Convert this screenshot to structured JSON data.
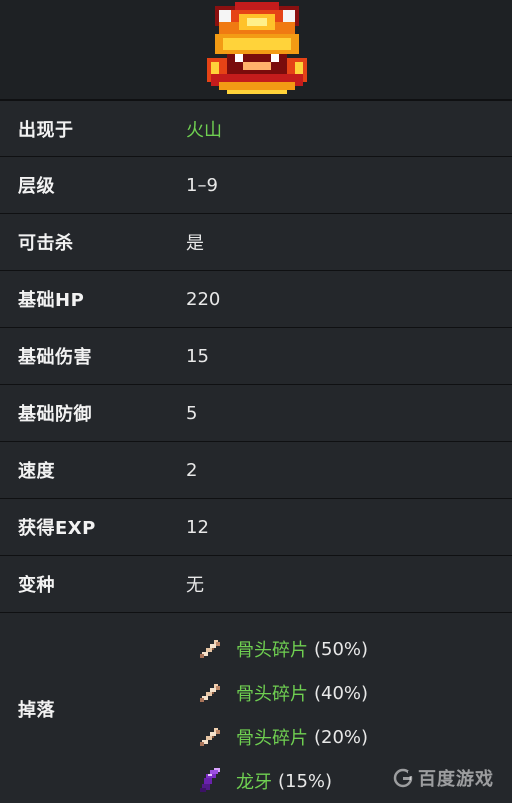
{
  "monster": {
    "sprite_icon": "flame-monster-sprite"
  },
  "stats": [
    {
      "label": "出现于",
      "value": "火山",
      "link": true
    },
    {
      "label": "层级",
      "value": "1–9",
      "link": false
    },
    {
      "label": "可击杀",
      "value": "是",
      "link": false
    },
    {
      "label": "基础HP",
      "value": "220",
      "link": false
    },
    {
      "label": "基础伤害",
      "value": "15",
      "link": false
    },
    {
      "label": "基础防御",
      "value": "5",
      "link": false
    },
    {
      "label": "速度",
      "value": "2",
      "link": false
    },
    {
      "label": "获得EXP",
      "value": "12",
      "link": false
    },
    {
      "label": "变种",
      "value": "无",
      "link": false
    }
  ],
  "drops": {
    "label": "掉落",
    "items": [
      {
        "name": "骨头碎片",
        "rate": "(50%)",
        "icon": "bone-fragment-icon"
      },
      {
        "name": "骨头碎片",
        "rate": "(40%)",
        "icon": "bone-fragment-icon"
      },
      {
        "name": "骨头碎片",
        "rate": "(20%)",
        "icon": "bone-fragment-icon"
      },
      {
        "name": "龙牙",
        "rate": "(15%)",
        "icon": "dragon-tooth-icon"
      }
    ]
  },
  "watermark": {
    "text": "百度游戏"
  },
  "colors": {
    "link": "#6fcf51",
    "row_bg": "#24272b",
    "border": "#0f1012"
  }
}
